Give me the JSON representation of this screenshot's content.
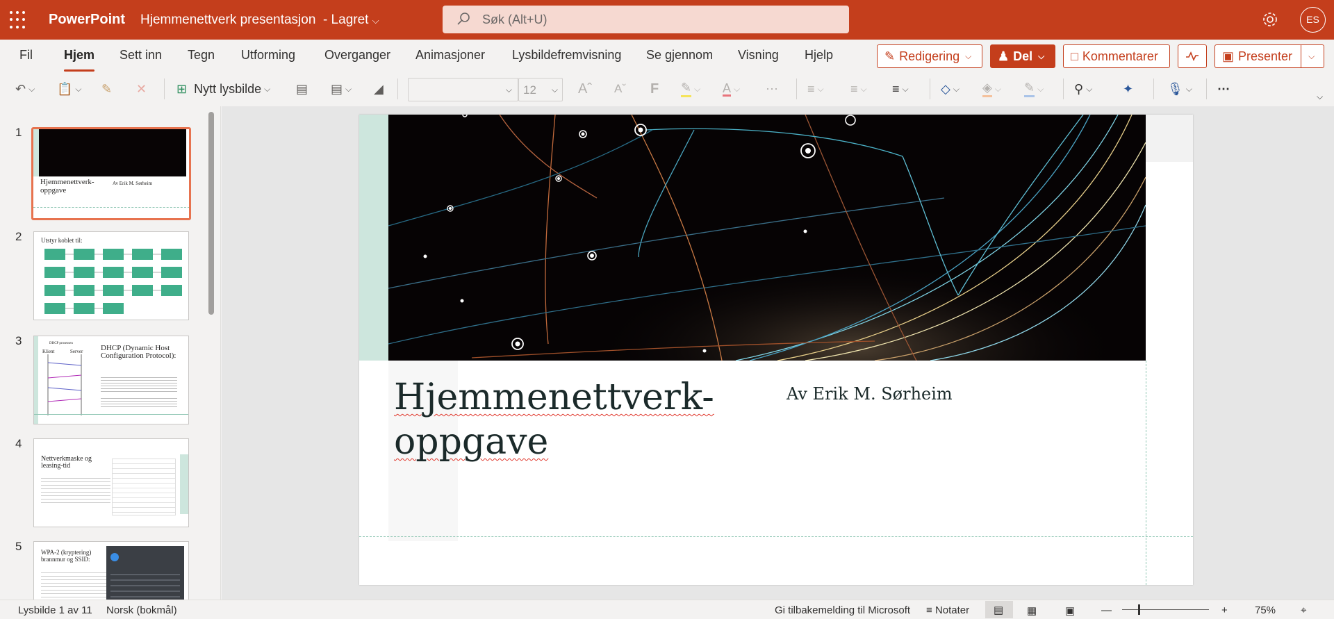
{
  "titlebar": {
    "app_name": "PowerPoint",
    "doc_name": "Hjemmenettverk presentasjon",
    "save_status": "-  Lagret",
    "search_placeholder": "Søk (Alt+U)",
    "avatar_initials": "ES",
    "bg_color": "#c43e1c"
  },
  "tabs": [
    {
      "label": "Fil"
    },
    {
      "label": "Hjem",
      "active": true
    },
    {
      "label": "Sett inn"
    },
    {
      "label": "Tegn"
    },
    {
      "label": "Utforming"
    },
    {
      "label": "Overganger"
    },
    {
      "label": "Animasjoner"
    },
    {
      "label": "Lysbildefremvisning"
    },
    {
      "label": "Se gjennom"
    },
    {
      "label": "Visning"
    },
    {
      "label": "Hjelp"
    }
  ],
  "ribbon_right": {
    "editing_label": "Redigering",
    "share_label": "Del",
    "comments_label": "Kommentarer",
    "present_label": "Presenter"
  },
  "toolbar": {
    "new_slide_label": "Nytt lysbilde",
    "font_name": "",
    "font_size": "12"
  },
  "slides": [
    {
      "number": "1",
      "title": "Hjemmenettverk-\noppgave",
      "subtitle": "Av Erik M. Sørheim",
      "selected": true
    },
    {
      "number": "2",
      "title": "Utstyr koblet til:"
    },
    {
      "number": "3",
      "title": "DHCP (Dynamic Host Configuration Protocol):",
      "label_left": "Klient",
      "label_right": "Server",
      "caption": "DHCP prosessen"
    },
    {
      "number": "4",
      "title": "Nettverkmaske og leasing-tid"
    },
    {
      "number": "5",
      "title": "WPA-2 (kryptering) brannmur og SSID:"
    }
  ],
  "main_slide": {
    "title_line1": "Hjemmenettverk-",
    "title_line2": "oppgave",
    "subtitle": "Av Erik M. Sørheim"
  },
  "statusbar": {
    "slide_counter": "Lysbilde 1 av 11",
    "language": "Norsk (bokmål)",
    "feedback": "Gi tilbakemelding til Microsoft",
    "notes": "Notater",
    "zoom": "75%"
  }
}
